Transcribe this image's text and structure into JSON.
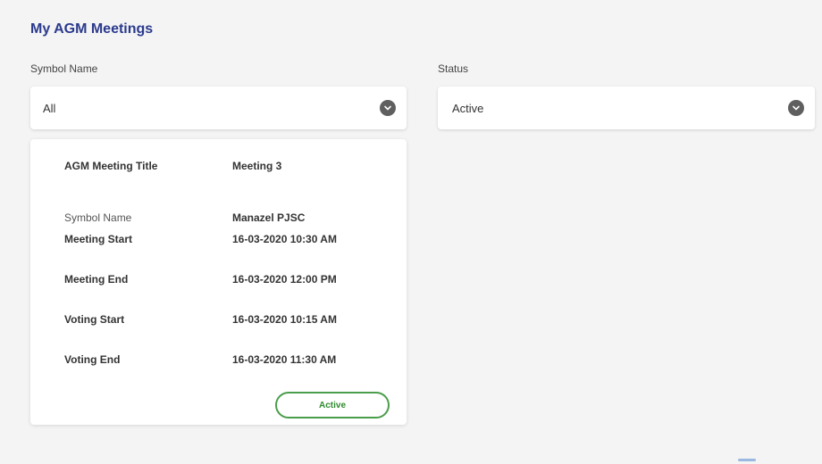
{
  "page": {
    "title": "My AGM Meetings"
  },
  "filters": {
    "symbol": {
      "label": "Symbol Name",
      "value": "All",
      "icon": "chevron-down-icon"
    },
    "status": {
      "label": "Status",
      "value": "Active",
      "icon": "chevron-down-icon"
    }
  },
  "meeting_card": {
    "title_label": "AGM Meeting Title",
    "title_value": "Meeting 3",
    "fields": [
      {
        "label": "Symbol Name",
        "value": "Manazel PJSC"
      },
      {
        "label": "Meeting Start",
        "value": "16-03-2020 10:30 AM"
      },
      {
        "label": "Meeting End",
        "value": "16-03-2020 12:00 PM"
      },
      {
        "label": "Voting Start",
        "value": "16-03-2020 10:15 AM"
      },
      {
        "label": "Voting End",
        "value": "16-03-2020 11:30 AM"
      }
    ],
    "status_label": "Active",
    "status_color": "#4a9d4a"
  }
}
